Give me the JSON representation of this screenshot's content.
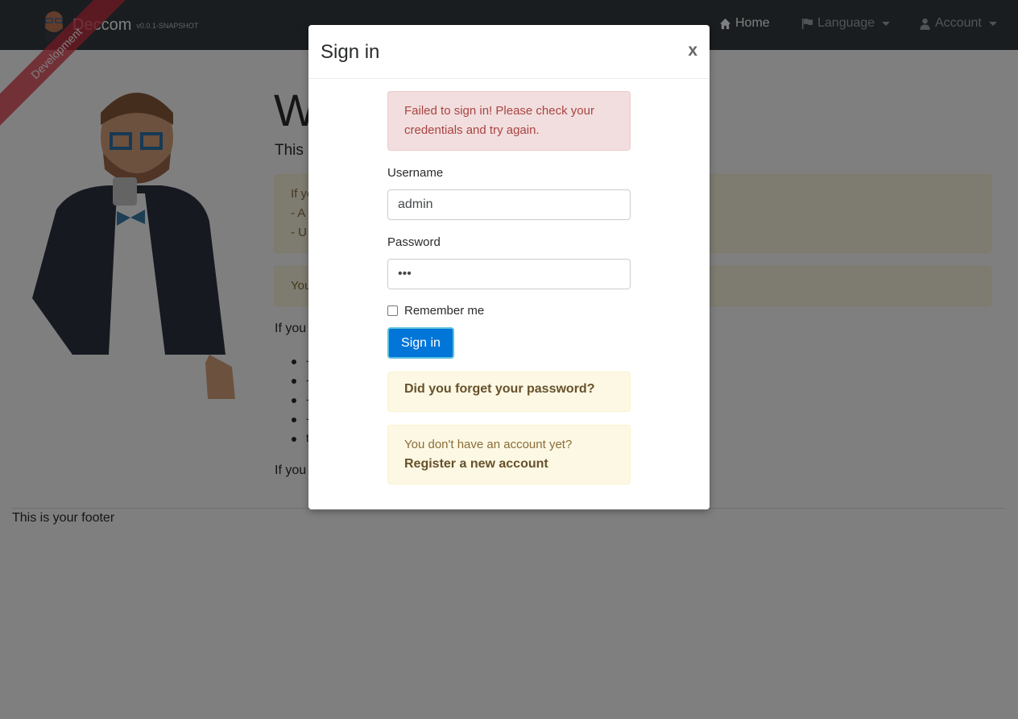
{
  "navbar": {
    "brand_name": "Deccom",
    "brand_version": "v0.0.1-SNAPSHOT",
    "ribbon": "Development",
    "items": [
      {
        "label": "Home",
        "icon": "home-icon"
      },
      {
        "label": "Language",
        "icon": "flag-icon"
      },
      {
        "label": "Account",
        "icon": "user-icon"
      }
    ]
  },
  "page": {
    "title_partial": "W",
    "lead_partial": "This i",
    "alert1_lines": [
      "If yo",
      "- A",
      "- U"
    ],
    "alert2_partial": "You",
    "text1_partial": "If you",
    "bullets": [
      "-",
      "-",
      "-",
      "-",
      "t"
    ],
    "text2_partial": "If you",
    "footer": "This is your footer"
  },
  "modal": {
    "title": "Sign in",
    "close": "x",
    "error_strong": "Failed to sign in!",
    "error_text": " Please check your credentials and try again.",
    "username_label": "Username",
    "username_value": "admin",
    "password_label": "Password",
    "password_value": "•••",
    "remember_label": "Remember me",
    "submit_label": "Sign in",
    "forgot_link": "Did you forget your password?",
    "no_account_text": "You don't have an account yet?",
    "register_link": "Register a new account"
  },
  "colors": {
    "navbar": "#343a40",
    "primary": "#0275d8",
    "danger_bg": "#f2dede",
    "warning_bg": "#fcf8e3",
    "ribbon": "#dc3545"
  }
}
